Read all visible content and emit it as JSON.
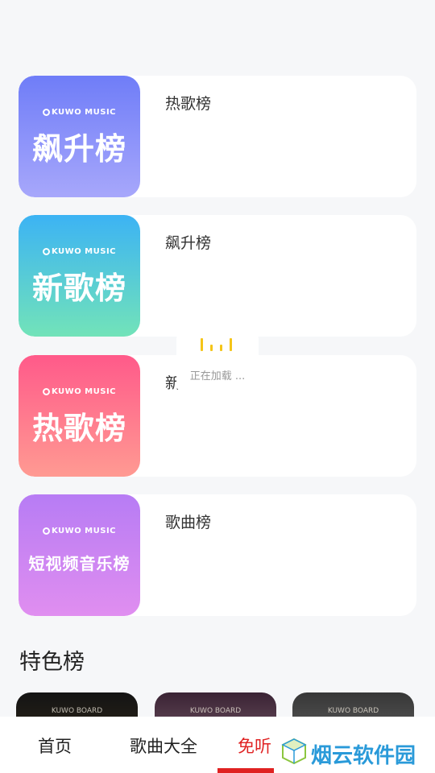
{
  "ranking_cards": [
    {
      "cover_brand": "KUWO MUSIC",
      "cover_text": "飙升榜",
      "title": "热歌榜"
    },
    {
      "cover_brand": "KUWO MUSIC",
      "cover_text": "新歌榜",
      "title": "飙升榜"
    },
    {
      "cover_brand": "KUWO MUSIC",
      "cover_text": "热歌榜",
      "title": "新"
    },
    {
      "cover_brand": "KUWO MUSIC",
      "cover_text": "短视频音乐榜",
      "title": "歌曲榜"
    }
  ],
  "loading": {
    "text": "正在加载 ..."
  },
  "section": {
    "title": "特色榜"
  },
  "featured_tiles": [
    {
      "tag": "KUWO BOARD"
    },
    {
      "tag": "KUWO BOARD"
    },
    {
      "tag": "KUWO BOARD"
    }
  ],
  "bottom_nav": {
    "items": [
      {
        "label": "首页"
      },
      {
        "label": "歌曲大全"
      },
      {
        "label": "免听"
      }
    ],
    "active": "免听"
  },
  "watermark": {
    "text": "烟云软件园"
  },
  "colors": {
    "accent_active": "#e02222",
    "loading_bars": "#f5c518",
    "watermark": "#2a9ad9"
  }
}
